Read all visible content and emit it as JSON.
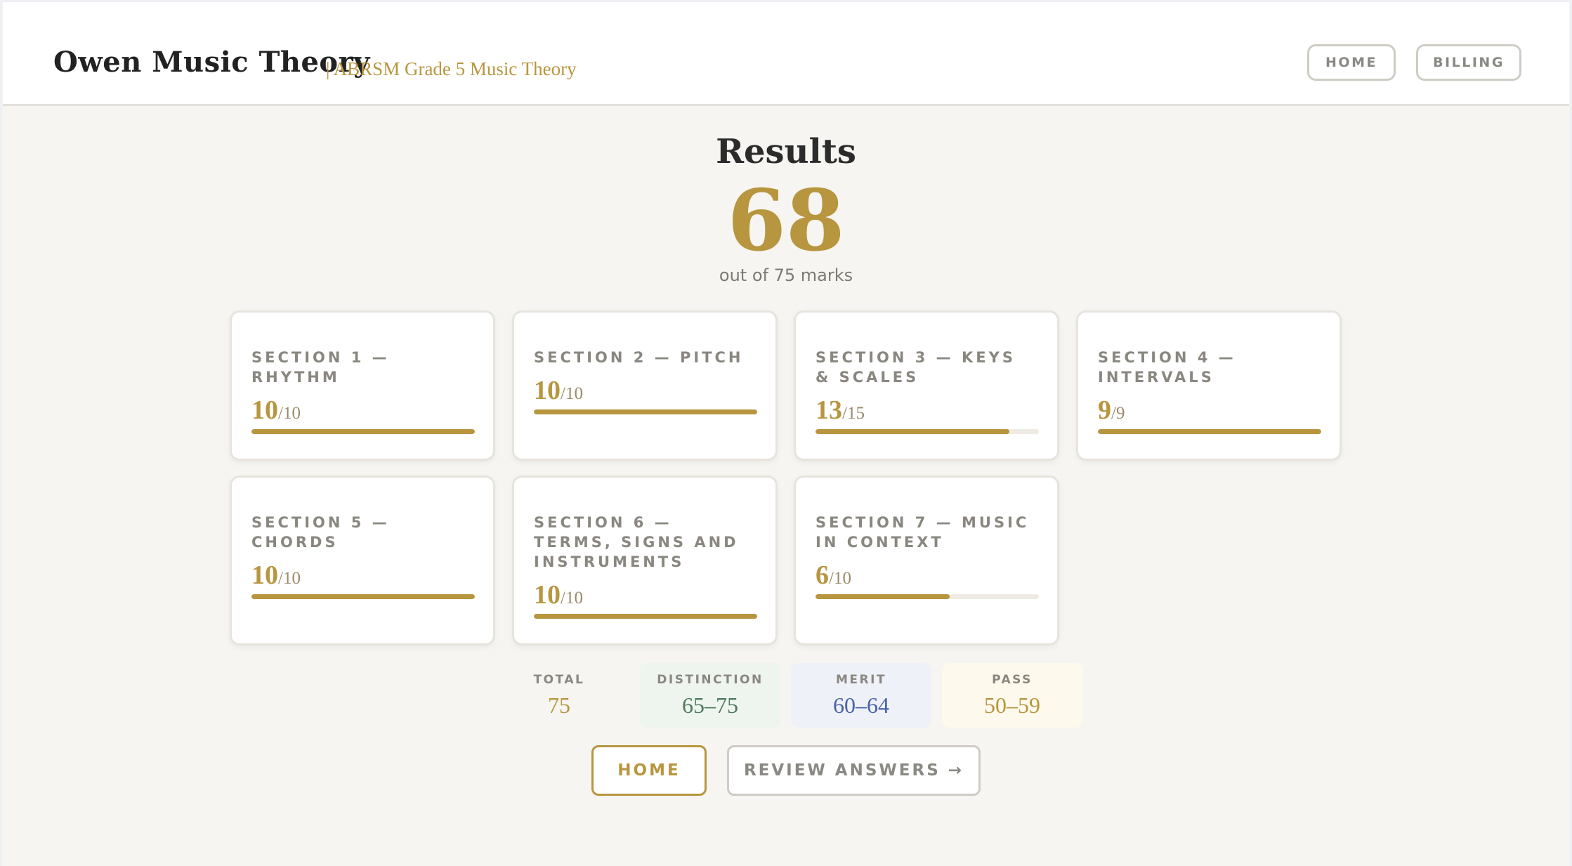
{
  "header": {
    "brand": "Owen Music Theory",
    "subtitle": "| ABRSM Grade 5 Music Theory",
    "nav": {
      "home": "HOME",
      "billing": "BILLING"
    }
  },
  "results": {
    "title": "Results",
    "score": "68",
    "score_caption": "out of 75 marks"
  },
  "sections": [
    {
      "title": "SECTION 1 — RHYTHM",
      "score": "10",
      "out_of": "/10",
      "fraction": 1.0
    },
    {
      "title": "SECTION 2 — PITCH",
      "score": "10",
      "out_of": "/10",
      "fraction": 1.0
    },
    {
      "title": "SECTION 3 — KEYS & SCALES",
      "score": "13",
      "out_of": "/15",
      "fraction": 0.8667
    },
    {
      "title": "SECTION 4 — INTERVALS",
      "score": "9",
      "out_of": "/9",
      "fraction": 1.0
    },
    {
      "title": "SECTION 5 — CHORDS",
      "score": "10",
      "out_of": "/10",
      "fraction": 1.0
    },
    {
      "title": "SECTION 6 — TERMS, SIGNS AND INSTRUMENTS",
      "score": "10",
      "out_of": "/10",
      "fraction": 1.0
    },
    {
      "title": "SECTION 7 — MUSIC IN CONTEXT",
      "score": "6",
      "out_of": "/10",
      "fraction": 0.6
    }
  ],
  "grades": [
    {
      "label": "TOTAL",
      "value": "75",
      "bg": "transparent",
      "color": "#b8963f"
    },
    {
      "label": "DISTINCTION",
      "value": "65–75",
      "bg": "#eef5ef",
      "color": "#4f7a5c"
    },
    {
      "label": "MERIT",
      "value": "60–64",
      "bg": "#eef1f8",
      "color": "#4a63a6"
    },
    {
      "label": "PASS",
      "value": "50–59",
      "bg": "#fdf9ec",
      "color": "#b8963f"
    }
  ],
  "actions": {
    "home": "HOME",
    "review": "REVIEW ANSWERS →"
  },
  "colors": {
    "accent": "#b8963f",
    "background": "#f6f5f1"
  }
}
